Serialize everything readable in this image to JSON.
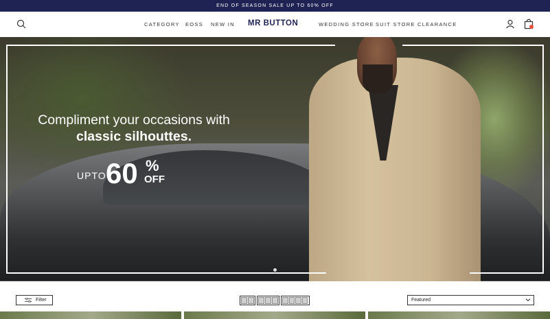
{
  "announcement": "END OF SEASON SALE UP TO 60% OFF",
  "header": {
    "logo": "MR BUTTON",
    "nav_left": [
      "CATEGORY",
      "EOSS",
      "NEW IN"
    ],
    "nav_right": [
      "WEDDING STORE",
      "SUIT STORE",
      "CLEARANCE"
    ],
    "icons": [
      "search-icon",
      "account-icon",
      "cart-icon"
    ]
  },
  "hero": {
    "headline_line1": "Compliment your occasions with",
    "headline_line2": "classic silhouttes.",
    "upto": "UPTO",
    "discount": "60",
    "percent": "%",
    "off": "OFF",
    "slide_count": 1
  },
  "toolbar": {
    "filter_label": "Filter",
    "sort_selected": "Featured",
    "grid_options": [
      2,
      3,
      4
    ]
  },
  "colors": {
    "announcement_bg": "#1f2353",
    "logo": "#1f2353",
    "cart_badge": "#e8543e"
  }
}
